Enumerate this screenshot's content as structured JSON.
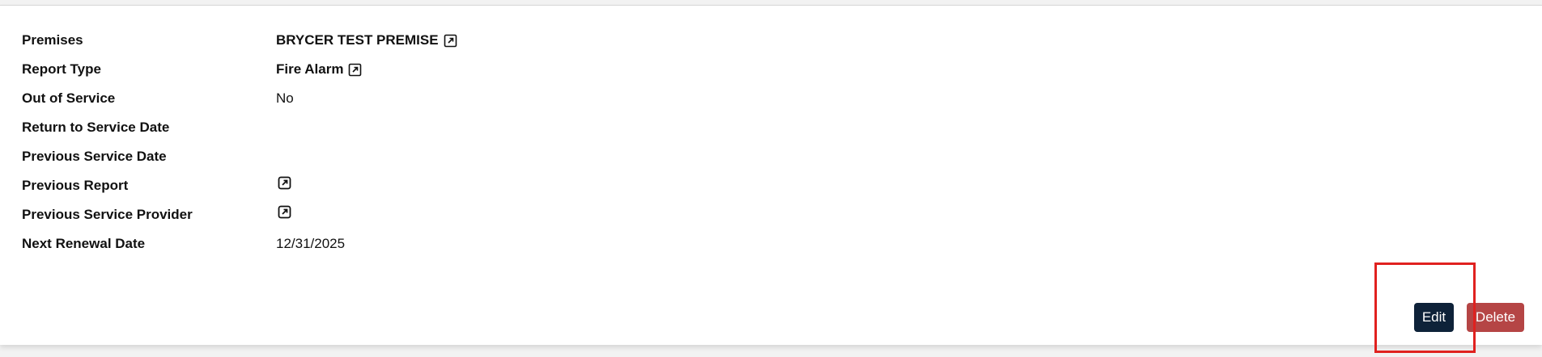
{
  "details": {
    "rows": [
      {
        "label": "Premises",
        "value": "BRYCER TEST PREMISE",
        "link": true,
        "bold": true
      },
      {
        "label": "Report Type",
        "value": "Fire Alarm",
        "link": true,
        "bold": true
      },
      {
        "label": "Out of Service",
        "value": "No",
        "link": false,
        "bold": false
      },
      {
        "label": "Return to Service Date",
        "value": "",
        "link": false,
        "bold": false
      },
      {
        "label": "Previous Service Date",
        "value": "",
        "link": false,
        "bold": false
      },
      {
        "label": "Previous Report",
        "value": "",
        "link": true,
        "bold": false
      },
      {
        "label": "Previous Service Provider",
        "value": "",
        "link": true,
        "bold": false
      },
      {
        "label": "Next Renewal Date",
        "value": "12/31/2025",
        "link": false,
        "bold": false
      }
    ]
  },
  "actions": {
    "edit_label": "Edit",
    "delete_label": "Delete",
    "edit_color": "#0e2239",
    "delete_color": "#b54545"
  },
  "annotation": {
    "highlight_color": "#e0211f"
  },
  "icons": {
    "external_link": "external-link-icon"
  }
}
